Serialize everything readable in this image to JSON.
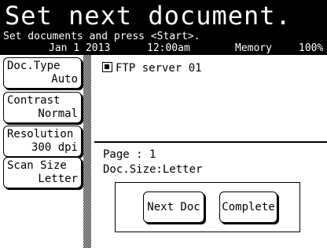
{
  "header": {
    "title": "Set next document.",
    "subtitle": "Set documents and press <Start>.",
    "status": {
      "date": "Jan  1 2013",
      "time": "12:00am",
      "memory_label": "Memory",
      "memory_percent": "100%"
    }
  },
  "sidebar": {
    "items": [
      {
        "label": "Doc.Type",
        "value": "Auto"
      },
      {
        "label": "Contrast",
        "value": "Normal"
      },
      {
        "label": "Resolution",
        "value": "300 dpi"
      },
      {
        "label": "Scan Size",
        "value": "Letter"
      }
    ]
  },
  "main": {
    "destination": {
      "icon": "ftp-server-icon",
      "label": "FTP server 01"
    },
    "page_line": "Page :  1",
    "size_line": "Doc.Size:Letter",
    "buttons": {
      "next_doc": "Next Doc",
      "complete": "Complete"
    }
  }
}
